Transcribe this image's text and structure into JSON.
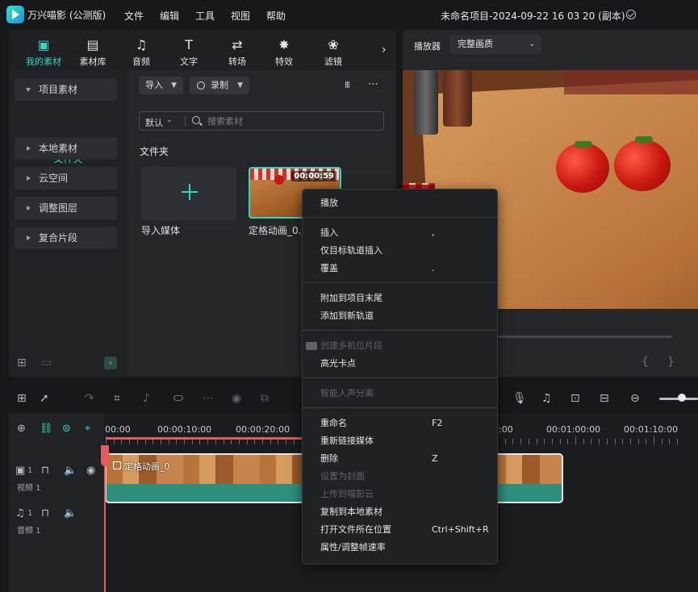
{
  "app": {
    "name": "万兴喵影 (公测版)",
    "project_title": "未命名项目-2024-09-22 16 03 20 (副本)"
  },
  "menubar": [
    "文件",
    "编辑",
    "工具",
    "视图",
    "帮助"
  ],
  "categories": [
    {
      "label": "我的素材",
      "icon": "my-media-icon",
      "glyph": "▣"
    },
    {
      "label": "素材库",
      "icon": "stock-media-icon",
      "glyph": "▤"
    },
    {
      "label": "音频",
      "icon": "music-note-icon",
      "glyph": "♫"
    },
    {
      "label": "文字",
      "icon": "text-icon",
      "glyph": "T"
    },
    {
      "label": "转场",
      "icon": "transition-icon",
      "glyph": "⇄"
    },
    {
      "label": "特效",
      "icon": "effects-icon",
      "glyph": "✸"
    },
    {
      "label": "滤镜",
      "icon": "filters-icon",
      "glyph": "❀"
    }
  ],
  "sidebar": {
    "items": [
      "项目素材",
      "本地素材",
      "云空间",
      "调整图层",
      "复合片段"
    ],
    "folder": "文件夹"
  },
  "library": {
    "import_label": "导入",
    "record_label": "录制",
    "sort_label": "默认",
    "search_placeholder": "搜索素材",
    "section_title": "文件夹",
    "import_media_label": "导入媒体",
    "clip_name": "定格动画_0.jpg",
    "clip_duration": "00:00:59"
  },
  "player": {
    "label": "播放器",
    "quality": "完整画质"
  },
  "ruler": [
    "00:00",
    "00:00:10:00",
    "00:00:20:00",
    ":00",
    "00:01:00:00",
    "00:01:10:00"
  ],
  "tracks": {
    "video_label": "视频 1",
    "audio_label": "音频 1",
    "video_count": "1",
    "audio_count": "1",
    "clip_title": "定格动画_0"
  },
  "context_menu": [
    {
      "label": "播放",
      "shortcut": "",
      "enabled": true
    },
    {
      "label": "插入",
      "shortcut": ",",
      "enabled": true
    },
    {
      "label": "仅目标轨道插入",
      "shortcut": "",
      "enabled": true
    },
    {
      "label": "覆盖",
      "shortcut": ".",
      "enabled": true
    },
    {
      "label": "附加到项目末尾",
      "shortcut": "",
      "enabled": true
    },
    {
      "label": "添加到新轨道",
      "shortcut": "",
      "enabled": true
    },
    {
      "label": "创建多机位片段",
      "shortcut": "",
      "enabled": false
    },
    {
      "label": "高光卡点",
      "shortcut": "",
      "enabled": true
    },
    {
      "label": "智能人声分离",
      "shortcut": "",
      "enabled": false
    },
    {
      "label": "重命名",
      "shortcut": "F2",
      "enabled": true
    },
    {
      "label": "重新链接媒体",
      "shortcut": "",
      "enabled": true
    },
    {
      "label": "删除",
      "shortcut": "Z",
      "enabled": true
    },
    {
      "label": "设置为封面",
      "shortcut": "",
      "enabled": false
    },
    {
      "label": "上传到喵影云",
      "shortcut": "",
      "enabled": false
    },
    {
      "label": "复制到本地素材",
      "shortcut": "",
      "enabled": true
    },
    {
      "label": "打开文件所在位置",
      "shortcut": "Ctrl+Shift+R",
      "enabled": true
    },
    {
      "label": "属性/调整帧速率",
      "shortcut": "",
      "enabled": true
    }
  ],
  "colors": {
    "accent": "#35d5c0",
    "playhead": "#e55b5b"
  }
}
